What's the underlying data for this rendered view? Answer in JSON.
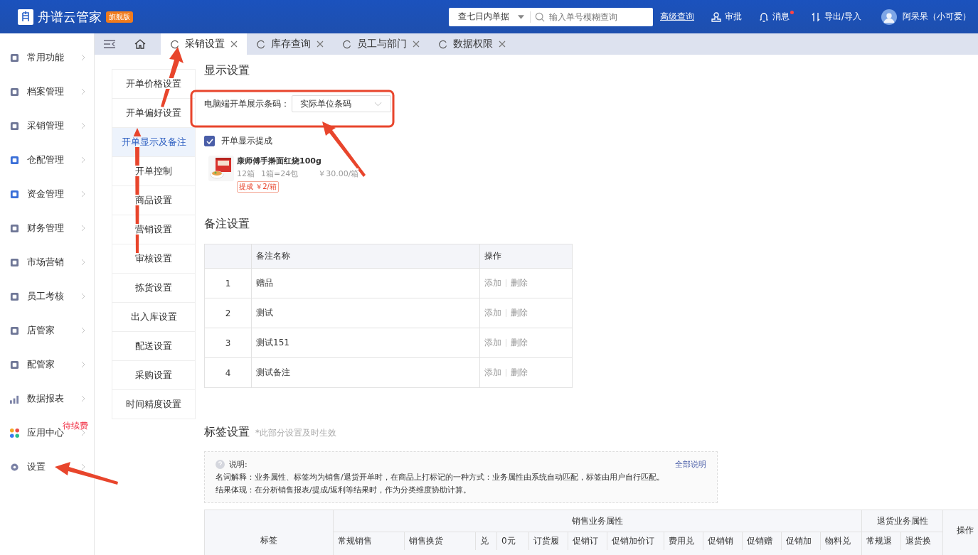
{
  "header": {
    "brand": "舟谱云管家",
    "edition": "旗舰版",
    "range_select": "查七日内单据",
    "search": {
      "placeholder": "输入单号模糊查询"
    },
    "advanced": "高级查询",
    "actions": [
      {
        "kind": "approve",
        "label": "审批",
        "dot": false
      },
      {
        "kind": "message",
        "label": "消息",
        "dot": true
      },
      {
        "kind": "transfer",
        "label": "导出/导入",
        "dot": false
      }
    ],
    "user": "阿呆呆（小可爱）"
  },
  "sidebar": {
    "items": [
      {
        "label": "常用功能"
      },
      {
        "label": "档案管理"
      },
      {
        "label": "采销管理"
      },
      {
        "label": "仓配管理"
      },
      {
        "label": "资金管理"
      },
      {
        "label": "财务管理"
      },
      {
        "label": "市场营销"
      },
      {
        "label": "员工考核"
      },
      {
        "label": "店管家"
      },
      {
        "label": "配管家"
      },
      {
        "label": "数据报表"
      },
      {
        "label": "应用中心",
        "badge": "待续费"
      },
      {
        "label": "设置"
      }
    ]
  },
  "tabs": [
    {
      "label": "采销设置",
      "selected": true
    },
    {
      "label": "库存查询",
      "selected": false
    },
    {
      "label": "员工与部门",
      "selected": false
    },
    {
      "label": "数据权限",
      "selected": false
    }
  ],
  "subnav": [
    {
      "label": "开单价格设置",
      "selected": false
    },
    {
      "label": "开单偏好设置",
      "selected": false
    },
    {
      "label": "开单显示及备注",
      "selected": true
    },
    {
      "label": "开单控制",
      "selected": false
    },
    {
      "label": "商品设置",
      "selected": false
    },
    {
      "label": "营销设置",
      "selected": false
    },
    {
      "label": "审核设置",
      "selected": false
    },
    {
      "label": "拣货设置",
      "selected": false
    },
    {
      "label": "出入库设置",
      "selected": false
    },
    {
      "label": "配送设置",
      "selected": false
    },
    {
      "label": "采购设置",
      "selected": false
    },
    {
      "label": "时间精度设置",
      "selected": false
    }
  ],
  "display": {
    "title": "显示设置",
    "barcode_label": "电脑端开单展示条码：",
    "barcode_value": "实际单位条码",
    "commission": {
      "label": "开单显示提成",
      "checked": true
    },
    "product": {
      "name": "康师傅手擀面红烧100g",
      "qty": "12箱",
      "unit": "1箱=24包",
      "price": "￥30.00/箱",
      "tag": "提成 ￥2/箱"
    }
  },
  "remarks": {
    "title": "备注设置",
    "columns": [
      "备注名称",
      "操作"
    ],
    "rows": [
      {
        "no": "1",
        "name": "赠品",
        "add": "添加",
        "delete": "删除"
      },
      {
        "no": "2",
        "name": "测试",
        "add": "添加",
        "delete": "删除"
      },
      {
        "no": "3",
        "name": "测试151",
        "add": "添加",
        "delete": "删除"
      },
      {
        "no": "4",
        "name": "测试备注",
        "add": "添加",
        "delete": "删除"
      }
    ]
  },
  "labels": {
    "title": "标签设置",
    "note": "*此部分设置及时生效",
    "info": {
      "heading": "说明:",
      "link": "全部说明",
      "lines": [
        "名词解释：业务属性、标签均为销售/退货开单时，在商品上打标记的一种方式：业务属性由系统自动匹配，标签由用户自行匹配。",
        "结果体现：在分析销售报表/提成/返利等结果时，作为分类维度协助计算。"
      ]
    },
    "table": {
      "label_col": "标签",
      "groups": [
        {
          "label": "销售业务属性",
          "columns": [
            "常规销售",
            "销售换货",
            "兑",
            "0元",
            "订货履",
            "促销订",
            "促销加价订",
            "费用兑",
            "促销销",
            "促销赠",
            "促销加",
            "物料兑"
          ]
        },
        {
          "label": "退货业务属性",
          "columns": [
            "常规退",
            "退货换"
          ]
        }
      ],
      "action_col": "操作"
    }
  }
}
